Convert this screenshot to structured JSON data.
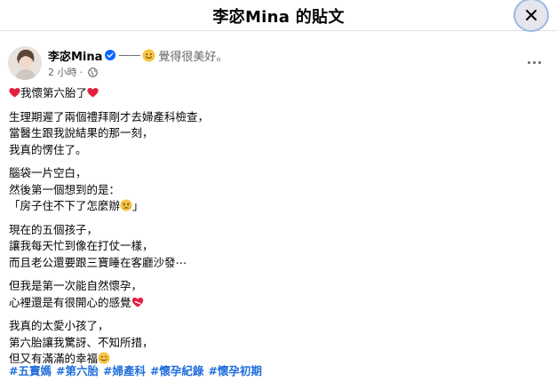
{
  "header": {
    "title": "李宓Mina 的貼文",
    "close_icon": "close-icon"
  },
  "post": {
    "author": "李宓Mina",
    "feeling_prefix": "——",
    "feeling_text": "覺得很美好。",
    "time": "2 小時",
    "separator": "·",
    "first_line": "我懷第六胎了",
    "paragraphs": [
      [
        "生理期遲了兩個禮拜剛才去婦產科檢查，",
        "當醫生跟我說結果的那一刻，",
        "我真的愣住了。"
      ],
      [
        "腦袋一片空白，",
        "然後第一個想到的是：",
        "「房子住不下了怎麼辦",
        "」"
      ],
      [
        "現在的五個孩子，",
        "讓我每天忙到像在打仗一樣，",
        "而且老公還要跟三寶睡在客廳沙發⋯"
      ],
      [
        "但我是第一次能自然懷孕，",
        "心裡還是有很開心的感覺"
      ],
      [
        "我真的太愛小孩了，",
        "第六胎讓我驚訝、不知所措，",
        "但又有滿滿的幸福"
      ]
    ],
    "hashtags": [
      "#五寶媽",
      "#第六胎",
      "#婦產科",
      "#懷孕紀錄",
      "#懷孕初期"
    ]
  },
  "colors": {
    "link": "#216fdb",
    "verified": "#0866ff",
    "heart": "#e41e3f",
    "muted": "#65676b"
  }
}
